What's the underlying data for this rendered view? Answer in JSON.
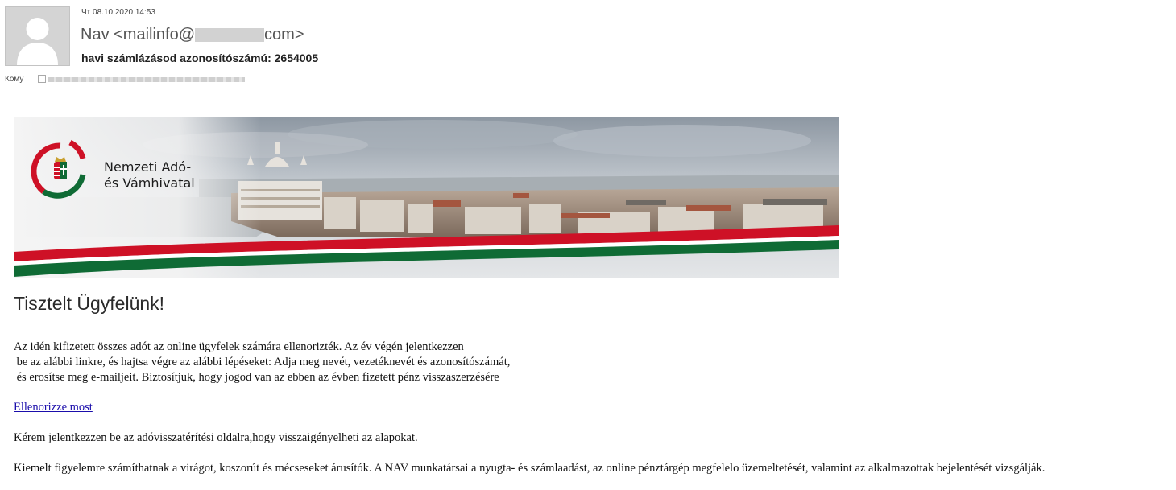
{
  "header": {
    "date": "Чт 08.10.2020 14:53",
    "from_name": "Nav <mailinfo@",
    "from_suffix": "com>",
    "subject": "havi számlázásod azonosítószámú: 2654005",
    "to_label": "Кому"
  },
  "banner": {
    "logo_line1": "Nemzeti Adó-",
    "logo_line2": "és Vámhivatal",
    "flag_colors": [
      "#ce1126",
      "#ffffff",
      "#0f6b35"
    ]
  },
  "body": {
    "greeting": "Tisztelt Ügyfelünk!",
    "paragraph": [
      "Az idén kifizetett összes adót az online ügyfelek számára ellenorizték. Az év végén jelentkezzen",
      " be az alábbi linkre, és hajtsa végre az alábbi lépéseket: Adja meg nevét, vezetéknevét és azonosítószámát,",
      " és erosítse meg e-mailjeit. Biztosítjuk, hogy jogod van az ebben az évben fizetett pénz visszaszerzésére"
    ],
    "link_text": "Ellenorizze most",
    "line2": "Kérem jelentkezzen be az adóvisszatérítési oldalra,hogy visszaigényelheti az alapokat.",
    "line3": "Kiemelt figyelemre számíthatnak a virágot, koszorút és mécseseket árusítók. A NAV munkatársai a nyugta- és számlaadást, az online pénztárgép megfelelo üzemeltetését, valamint az alkalmazottak bejelentését vizsgálják."
  },
  "icons": {
    "avatar": "user-avatar-icon",
    "recipient_checkbox": "checkbox-icon"
  }
}
